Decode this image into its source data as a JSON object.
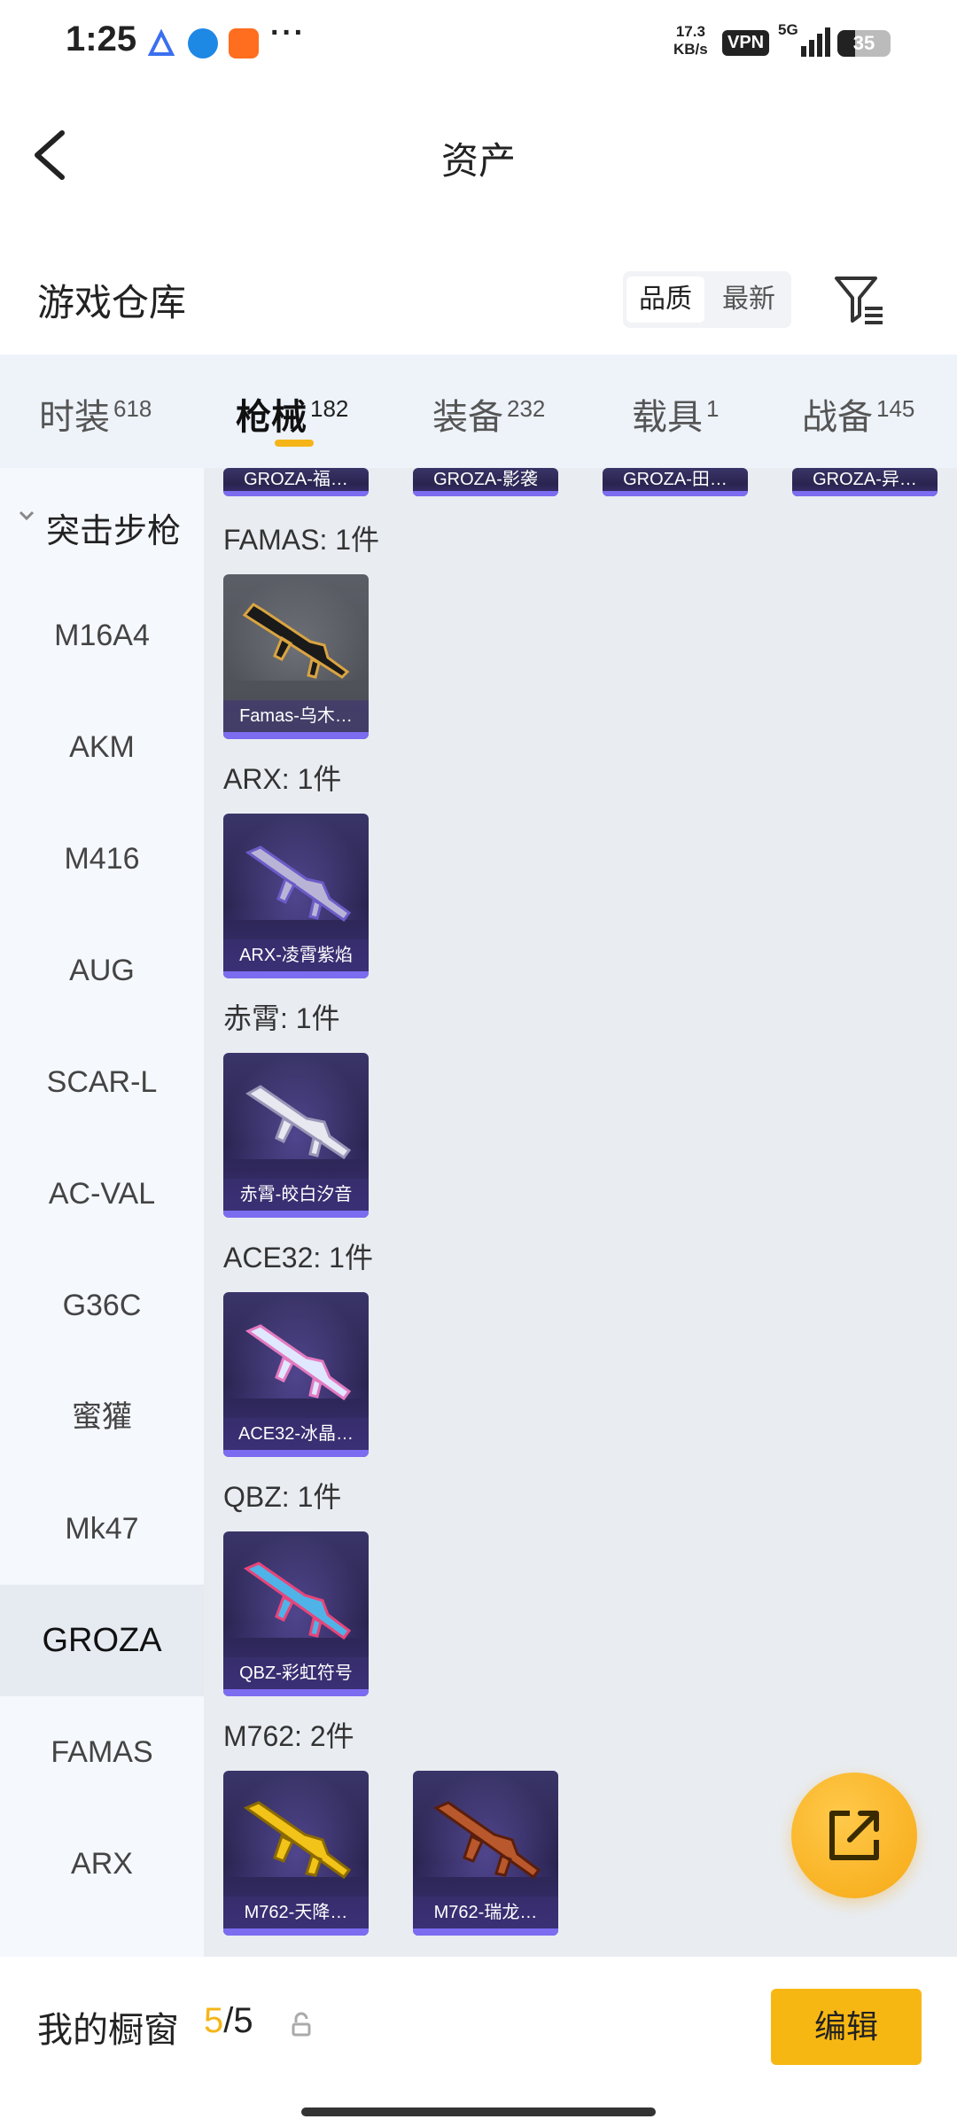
{
  "status_bar": {
    "time": "1:25",
    "speed_value": "17.3",
    "speed_unit": "KB/s",
    "vpn": "VPN",
    "network": "5G",
    "battery": "35"
  },
  "nav": {
    "title": "资产",
    "back_icon": "chevron-left-icon"
  },
  "section": {
    "title": "游戏仓库",
    "sort_options": [
      "品质",
      "最新"
    ],
    "sort_active": "品质",
    "filter_icon": "filter-icon"
  },
  "tabs": [
    {
      "label": "时装",
      "count": "618"
    },
    {
      "label": "枪械",
      "count": "182",
      "active": true
    },
    {
      "label": "装备",
      "count": "232"
    },
    {
      "label": "载具",
      "count": "1"
    },
    {
      "label": "战备",
      "count": "145"
    }
  ],
  "sidebar": {
    "group": "突击步枪",
    "items": [
      "M16A4",
      "AKM",
      "M416",
      "AUG",
      "SCAR-L",
      "AC-VAL",
      "G36C",
      "蜜獾",
      "Mk47",
      "GROZA",
      "FAMAS",
      "ARX"
    ],
    "active": "GROZA"
  },
  "content": {
    "top_row": [
      "GROZA-福…",
      "GROZA-影袭",
      "GROZA-田…",
      "GROZA-异…"
    ],
    "groups": [
      {
        "title": "FAMAS: 1件",
        "items": [
          "Famas-乌木…"
        ]
      },
      {
        "title": "ARX: 1件",
        "items": [
          "ARX-凌霄紫焰"
        ]
      },
      {
        "title": "赤霄: 1件",
        "items": [
          "赤霄-皎白汐音"
        ]
      },
      {
        "title": "ACE32: 1件",
        "items": [
          "ACE32-冰晶…"
        ]
      },
      {
        "title": "QBZ: 1件",
        "items": [
          "QBZ-彩虹符号"
        ]
      },
      {
        "title": "M762: 2件",
        "items": [
          "M762-天降…",
          "M762-瑞龙…"
        ]
      }
    ]
  },
  "fab": {
    "icon": "share-external-icon"
  },
  "bottom": {
    "title": "我的橱窗",
    "used": "5",
    "total": "/5",
    "lock_icon": "lock-icon",
    "edit_label": "编辑"
  },
  "colors": {
    "accent": "#f5b518",
    "card_bg": "#2a2450",
    "card_bar": "#7b6cf0"
  }
}
